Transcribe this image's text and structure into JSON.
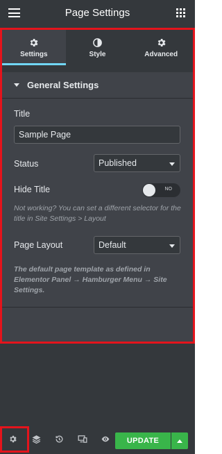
{
  "header": {
    "title": "Page Settings",
    "menu_icon": "hamburger-icon",
    "apps_icon": "grid-icon"
  },
  "tabs": [
    {
      "label": "Settings",
      "icon": "gear-icon",
      "active": true
    },
    {
      "label": "Style",
      "icon": "contrast-icon",
      "active": false
    },
    {
      "label": "Advanced",
      "icon": "gear-icon",
      "active": false
    }
  ],
  "section": {
    "title": "General Settings",
    "title_field": {
      "label": "Title",
      "value": "Sample Page"
    },
    "status_field": {
      "label": "Status",
      "value": "Published"
    },
    "hide_title": {
      "label": "Hide Title",
      "toggle_text": "NO"
    },
    "hide_title_note": "Not working? You can set a different selector for the title in Site Settings > Layout",
    "layout_field": {
      "label": "Page Layout",
      "value": "Default"
    },
    "layout_note": "The default page template as defined in Elementor Panel → Hamburger Menu → Site Settings."
  },
  "footer": {
    "icons": [
      "gear-icon",
      "layers-icon",
      "history-icon",
      "responsive-icon",
      "eye-icon"
    ],
    "update_label": "UPDATE"
  },
  "colors": {
    "accent": "#71d7f7",
    "update": "#39b54a",
    "highlight": "#e4141c",
    "panel": "#34383c"
  }
}
